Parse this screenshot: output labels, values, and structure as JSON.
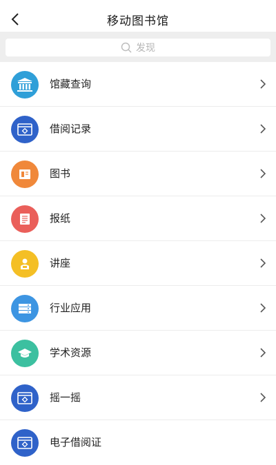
{
  "header": {
    "title": "移动图书馆"
  },
  "search": {
    "placeholder": "发现"
  },
  "items": [
    {
      "label": "馆藏查询",
      "icon": "library-building-icon",
      "color": "#2f9fd8"
    },
    {
      "label": "借阅记录",
      "icon": "browser-window-icon",
      "color": "#2f62c9"
    },
    {
      "label": "图书",
      "icon": "book-icon",
      "color": "#f0883a"
    },
    {
      "label": "报纸",
      "icon": "newspaper-icon",
      "color": "#ea5f5a"
    },
    {
      "label": "讲座",
      "icon": "lecture-icon",
      "color": "#f4bf25"
    },
    {
      "label": "行业应用",
      "icon": "industry-app-icon",
      "color": "#3d95e2"
    },
    {
      "label": "学术资源",
      "icon": "graduation-cap-icon",
      "color": "#3cc0a0"
    },
    {
      "label": "摇一摇",
      "icon": "browser-window-icon",
      "color": "#2f62c9"
    },
    {
      "label": "电子借阅证",
      "icon": "browser-window-icon",
      "color": "#2f62c9"
    }
  ]
}
